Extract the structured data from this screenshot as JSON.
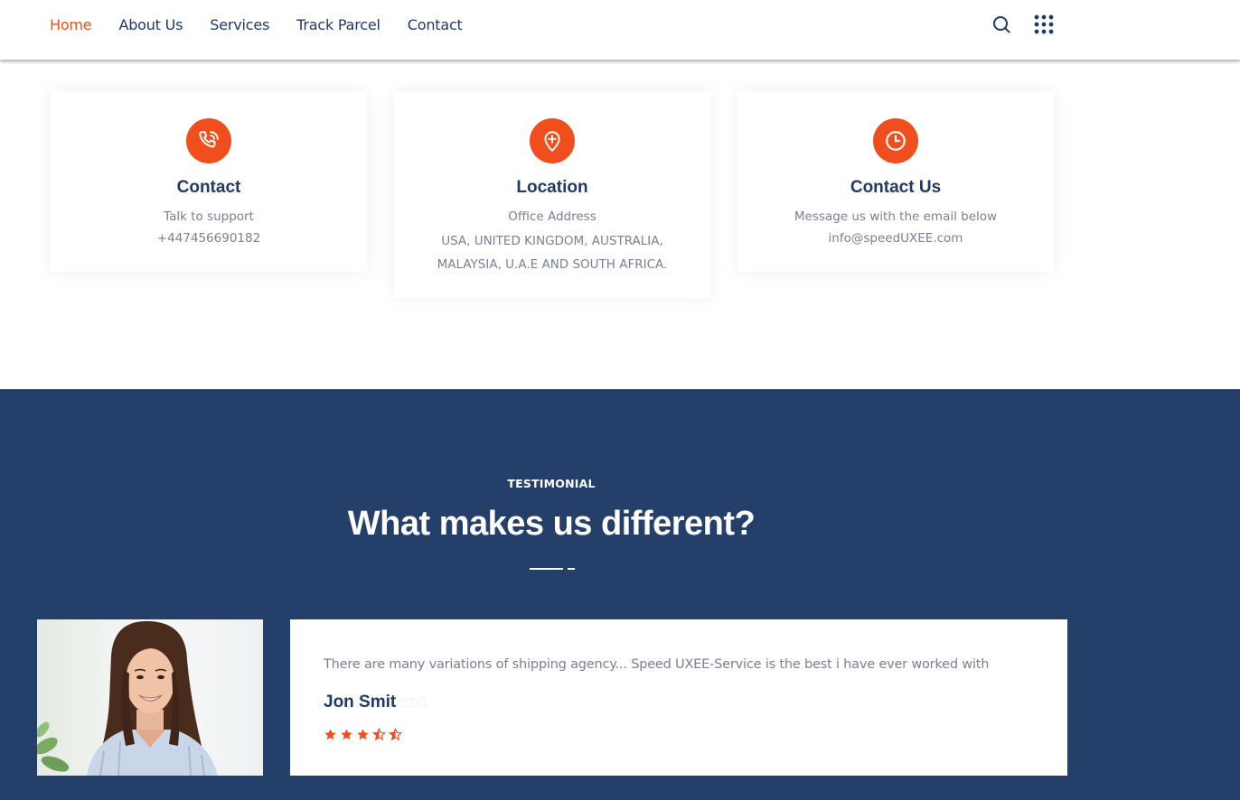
{
  "nav": {
    "items": [
      {
        "label": "Home",
        "active": true
      },
      {
        "label": "About Us",
        "active": false
      },
      {
        "label": "Services",
        "active": false
      },
      {
        "label": "Track Parcel",
        "active": false
      },
      {
        "label": "Contact",
        "active": false
      }
    ],
    "icons": [
      "search-icon",
      "grid-menu-icon"
    ]
  },
  "cards": [
    {
      "icon": "phone-icon",
      "title": "Contact",
      "lines": [
        "Talk to support",
        "+447456690182"
      ]
    },
    {
      "icon": "location-pin-icon",
      "title": "Location",
      "lines": [
        "Office Address",
        "USA, UNITED KINGDOM, AUSTRALIA,",
        "MALAYSIA, U.A.E AND SOUTH AFRICA."
      ]
    },
    {
      "icon": "clock-icon",
      "title": "Contact Us",
      "lines": [
        "Message us with the email below",
        "info@speedUXEE.com"
      ]
    }
  ],
  "testimonial": {
    "eyebrow": "TESTIMONIAL",
    "heading": "What makes us different?",
    "quote": "There are many variations of shipping agency... Speed UXEE-Service is the best i have ever worked with",
    "author": "Jon Smit",
    "author_role": "CEO",
    "rating": 4.5
  },
  "colors": {
    "accent": "#f04e1c",
    "navy": "#253f6b",
    "text_dark": "#1f3a66",
    "text_muted": "#7a7f95"
  }
}
